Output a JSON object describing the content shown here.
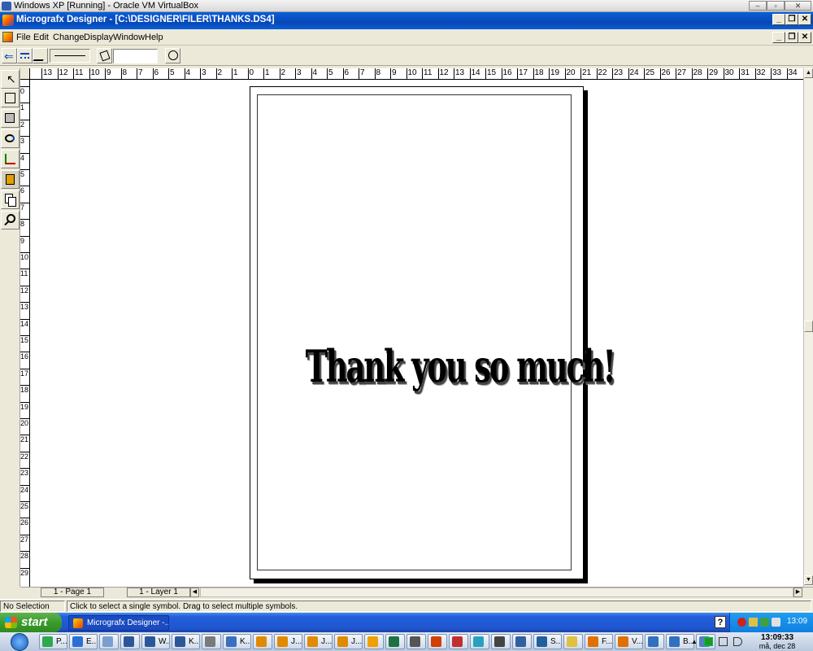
{
  "host_window": {
    "title": "Windows XP [Running] - Oracle VM VirtualBox"
  },
  "app": {
    "title": "Micrografx Designer - [C:\\DESIGNER\\FILER\\THANKS.DS4]"
  },
  "menu": [
    "File",
    "Edit",
    "Change",
    "Display",
    "Window",
    "Help"
  ],
  "toolbar": {
    "text_field_value": ""
  },
  "palette": [
    "#ffffff",
    "#d8d8d8",
    "#b0b0b0",
    "#000000",
    "#400000",
    "#800000",
    "#c00000",
    "#ff0000",
    "#ff4040",
    "#ff8000",
    "#ffc000",
    "#ffff00",
    "#c0ff00",
    "#80ff00",
    "#00c000",
    "#008000",
    "#00ff80",
    "#00ffff",
    "#0080ff",
    "#0000ff",
    "#000080",
    "#8000ff",
    "#ff00ff",
    "#ff80c0",
    "#ff8080",
    "#ff6000",
    "#ffb060",
    "#ffe080",
    "#e0e000",
    "#a0c000",
    "#60c060",
    "#40c080",
    "#20a0a0",
    "#40e0e0",
    "#60c0ff",
    "#4080c0",
    "#2060a0",
    "#6060c0",
    "#a080ff",
    "#c060c0",
    "#ff60ff",
    "#ff40a0",
    "#c04080",
    "#804040",
    "#a06040",
    "#c0a080",
    "#808000",
    "#406000",
    "#004000",
    "#004040",
    "#004080",
    "#202060",
    "#402060",
    "#602040",
    "#803000",
    "#c0c0c0",
    "#e0e0e0",
    "#a0a0a0",
    "#909090",
    "#606060",
    "#404040",
    "#303030",
    "#181818"
  ],
  "ruler_top": [
    "13",
    "12",
    "11",
    "10",
    "9",
    "8",
    "7",
    "6",
    "5",
    "4",
    "3",
    "2",
    "1",
    "0",
    "1",
    "2",
    "3",
    "4",
    "5",
    "6",
    "7",
    "8",
    "9",
    "10",
    "11",
    "12",
    "13",
    "14",
    "15",
    "16",
    "17",
    "18",
    "19",
    "20",
    "21",
    "22",
    "23",
    "24",
    "25",
    "26",
    "27",
    "28",
    "29",
    "30",
    "31",
    "32",
    "33",
    "34"
  ],
  "ruler_left": [
    "0",
    "1",
    "2",
    "3",
    "4",
    "5",
    "6",
    "7",
    "8",
    "9",
    "10",
    "11",
    "12",
    "13",
    "14",
    "15",
    "16",
    "17",
    "18",
    "19",
    "20",
    "21",
    "22",
    "23",
    "24",
    "25",
    "26",
    "27",
    "28",
    "29"
  ],
  "document": {
    "headline": "Thank you so much!"
  },
  "tabs": {
    "page": "1 - Page 1",
    "layer": "1 - Layer 1"
  },
  "status": {
    "selection": "No Selection",
    "hint": "Click to select a single symbol. Drag to select multiple symbols."
  },
  "taskbar": {
    "start_label": "start",
    "active_task": "Micrografx Designer -...",
    "tray_time": "13:09"
  },
  "host_taskbar": {
    "items": [
      "P...",
      "E...",
      "",
      "",
      "W...",
      "K...",
      "",
      "K...",
      "",
      "J...",
      "J...",
      "J...",
      "",
      "",
      "",
      "",
      "",
      "",
      "",
      "",
      "S...",
      "",
      "F...",
      "V...",
      "",
      "B...",
      ""
    ],
    "clock_time": "13:09:33",
    "clock_date": "må, dec 28"
  }
}
